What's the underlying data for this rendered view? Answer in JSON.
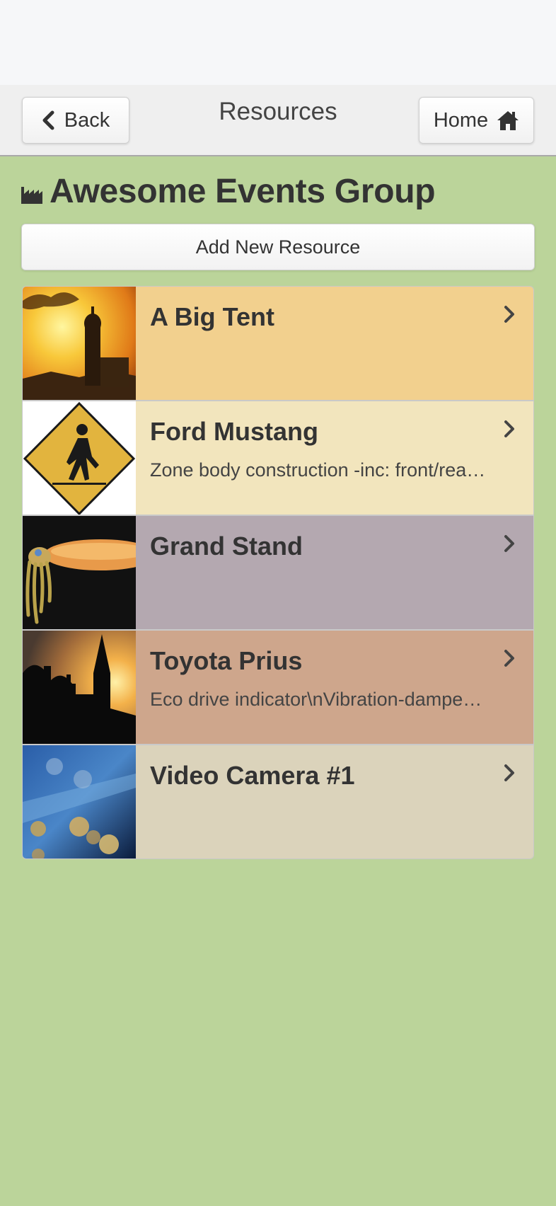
{
  "header": {
    "title": "Resources",
    "back_label": "Back",
    "home_label": "Home"
  },
  "group": {
    "title": "Awesome Events Group",
    "add_label": "Add New Resource"
  },
  "resources": [
    {
      "name": "A Big Tent",
      "description": "",
      "bg": "#f2d08e",
      "thumb": "sunset-church"
    },
    {
      "name": "Ford Mustang",
      "description": "Zone body construction -inc: front/rear crumple zones",
      "bg": "#f2e5bd",
      "thumb": "pedestrian-sign"
    },
    {
      "name": "Grand Stand",
      "description": "",
      "bg": "#b4a8b0",
      "thumb": "cuttlefish"
    },
    {
      "name": "Toyota Prius",
      "description": "Eco drive indicator\\nVibration-dampening",
      "bg": "#cea68c",
      "thumb": "minaret-silhouette"
    },
    {
      "name": "Video Camera #1",
      "description": "",
      "bg": "#dbd3bb",
      "thumb": "bokeh-lights"
    }
  ],
  "colors": {
    "page_bg": "#bbd49a",
    "header_bg": "#efefef",
    "status_bg": "#f6f7f9"
  }
}
